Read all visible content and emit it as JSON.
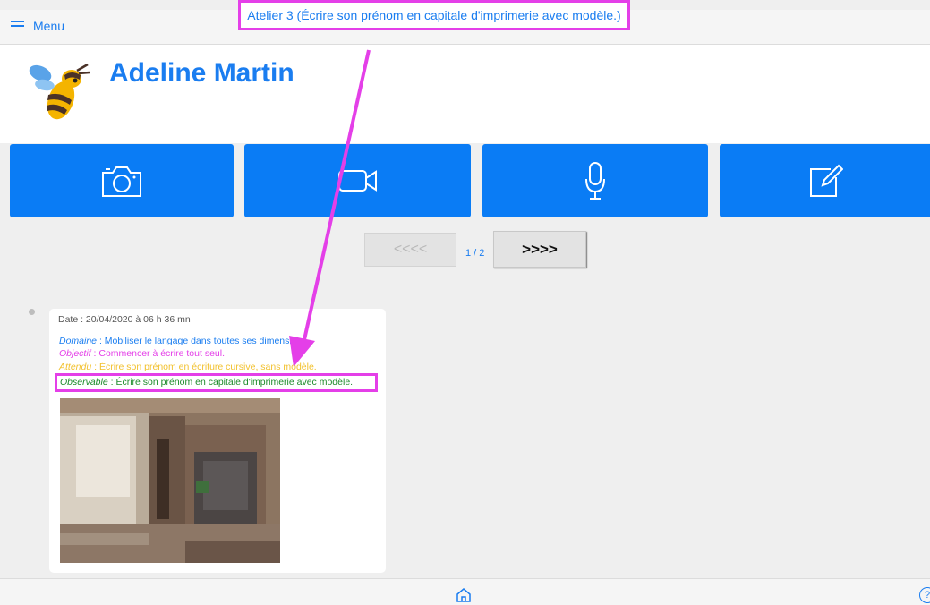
{
  "topbar": {
    "menu_label": "Menu",
    "title": "Atelier 3 (Écrire son prénom en capitale d'imprimerie avec modèle.)"
  },
  "header": {
    "name": "Adeline Martin"
  },
  "actions": [
    {
      "icon": "camera-icon"
    },
    {
      "icon": "video-camera-icon"
    },
    {
      "icon": "microphone-icon"
    },
    {
      "icon": "edit-note-icon"
    }
  ],
  "pager": {
    "prev_label": "<<<<",
    "count": "1 / 2",
    "next_label": ">>>>"
  },
  "entry": {
    "date": "Date : 20/04/2020 à 06 h 36 mn",
    "domaine_key": "Domaine",
    "domaine_value": " : Mobiliser le langage dans toutes ses dimensions.",
    "objectif_key": "Objectif",
    "objectif_value": " : Commencer à écrire tout seul.",
    "attendu_key": "Attendu",
    "attendu_value": " : Écrire son prénom en écriture cursive, sans modèle.",
    "observable_key": "Observable",
    "observable_value": " : Écrire son prénom en capitale d'imprimerie avec modèle."
  },
  "colors": {
    "accent": "#1a7df0",
    "button_blue": "#0a7cf5",
    "highlight": "#e43fe8",
    "objectif": "#e43fe8",
    "attendu": "#f2c12e",
    "observable": "#1c8a2a"
  },
  "footer": {
    "home_icon": "home-icon",
    "help_label": "?"
  }
}
